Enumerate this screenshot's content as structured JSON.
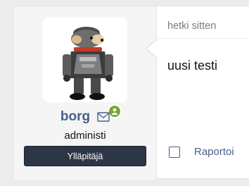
{
  "user": {
    "username": "borg",
    "title": "administi",
    "banner": "Ylläpitäjä",
    "avatar_icon": "avatar-image",
    "online_icon": "user-online-icon",
    "mail_icon": "envelope-icon"
  },
  "message": {
    "timestamp": "hetki sitten",
    "body": "uusi testi",
    "report_label": "Raportoi"
  },
  "colors": {
    "link": "#47608a",
    "banner_bg": "#2c3645",
    "online": "#79a52e"
  }
}
